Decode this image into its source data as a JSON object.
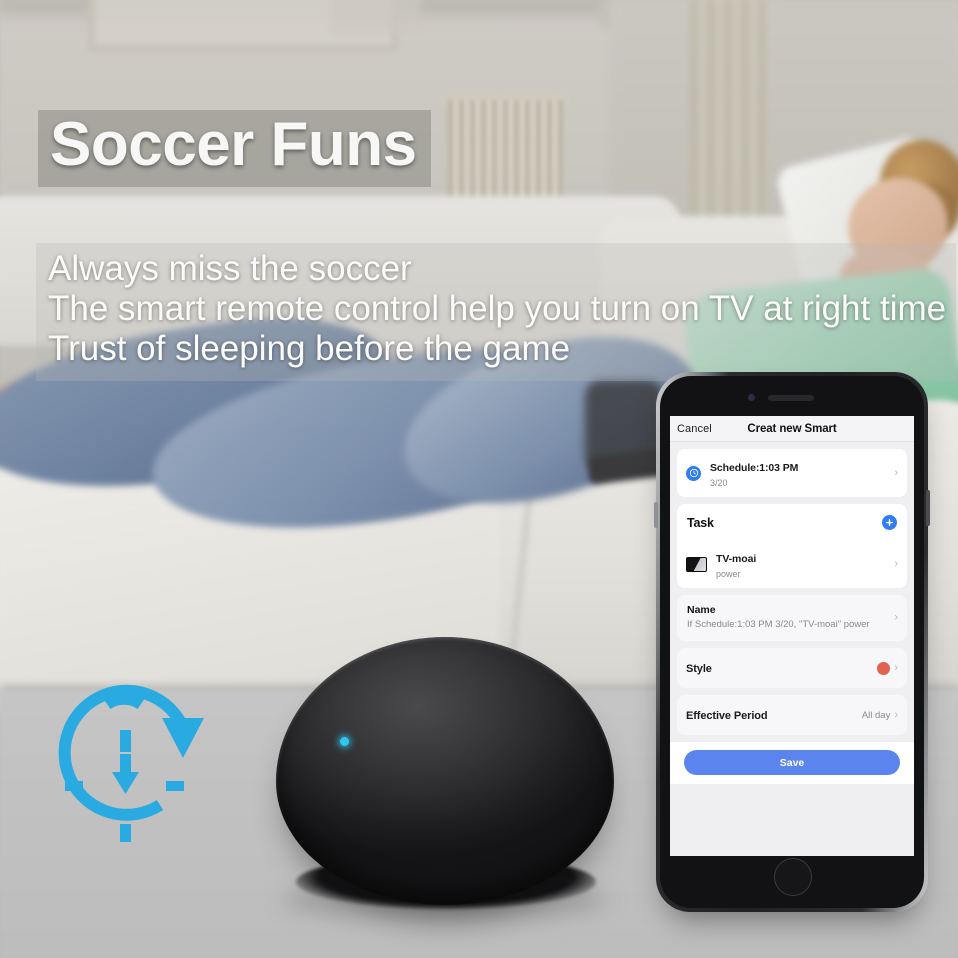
{
  "banner": {
    "headline": "Soccer Funs",
    "subtitles": [
      "Always miss the soccer",
      "The smart remote control help you turn on TV at right time",
      "Trust of sleeping before the game"
    ]
  },
  "graphics": {
    "timer_icon_name": "timer-clock-icon",
    "timer_icon_color": "#29ABE2",
    "hub_device_name": "smart-ir-remote-hub",
    "hub_led_color": "#2FC6F2",
    "scene": "person sleeping on couch in living room"
  },
  "phone": {
    "nav": {
      "cancel_label": "Cancel",
      "title": "Creat new Smart"
    },
    "schedule": {
      "title": "Schedule:1:03 PM",
      "subtitle": "3/20",
      "icon": "clock-icon",
      "icon_color": "#2F7DF0",
      "chevron": "›"
    },
    "task": {
      "label": "Task",
      "add_icon": "plus-icon",
      "add_color": "#2F7DF0",
      "items": [
        {
          "title": "TV-moai",
          "subtitle": "power",
          "icon": "tv-icon",
          "chevron": "›"
        }
      ]
    },
    "name": {
      "label": "Name",
      "value": "If Schedule:1:03 PM 3/20, \"TV-moai\" power",
      "chevron": "›"
    },
    "style": {
      "label": "Style",
      "color": "#E2614F",
      "chevron": "›"
    },
    "effective_period": {
      "label": "Effective Period",
      "value": "All day",
      "chevron": "›"
    },
    "save_label": "Save",
    "save_color": "#5B84EF"
  }
}
